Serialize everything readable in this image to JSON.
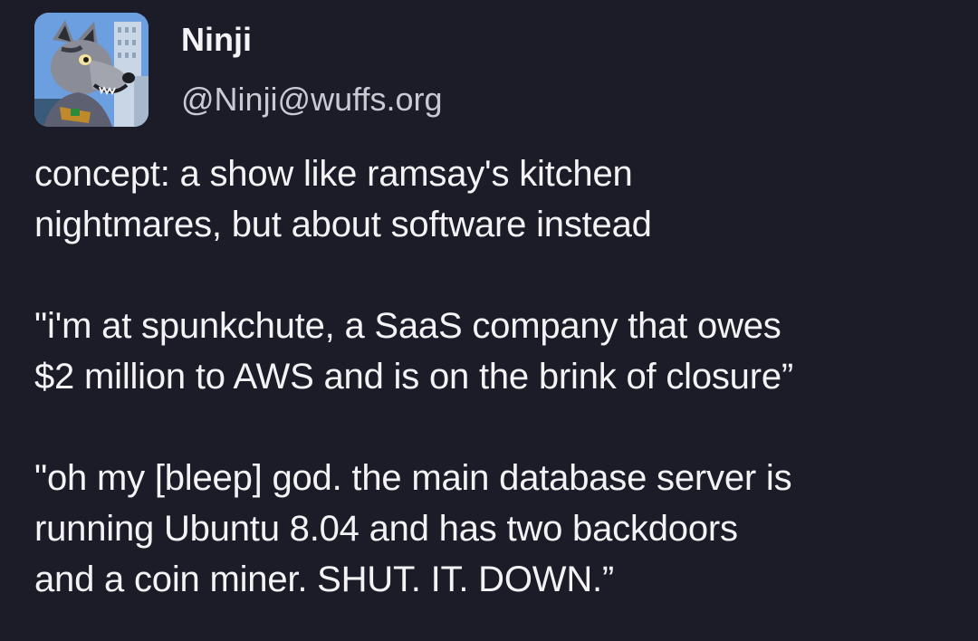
{
  "author": {
    "display_name": "Ninji",
    "handle": "@Ninji@wuffs.org",
    "avatar_icon": "wolf-fursuit-avatar"
  },
  "post": {
    "paragraphs": [
      "concept: a show like ramsay's kitchen\nnightmares, but about software instead",
      "\"i'm at spunkchute, a SaaS company that owes\n$2 million to AWS and is on the brink of closure”",
      "\"oh my [bleep] god. the main database server is\nrunning Ubuntu 8.04 and has two backdoors\nand a coin miner. SHUT. IT. DOWN.”"
    ]
  },
  "theme": {
    "background": "#1b1c28",
    "text": "#f3f3f5",
    "handle_text": "#c9cad2"
  }
}
